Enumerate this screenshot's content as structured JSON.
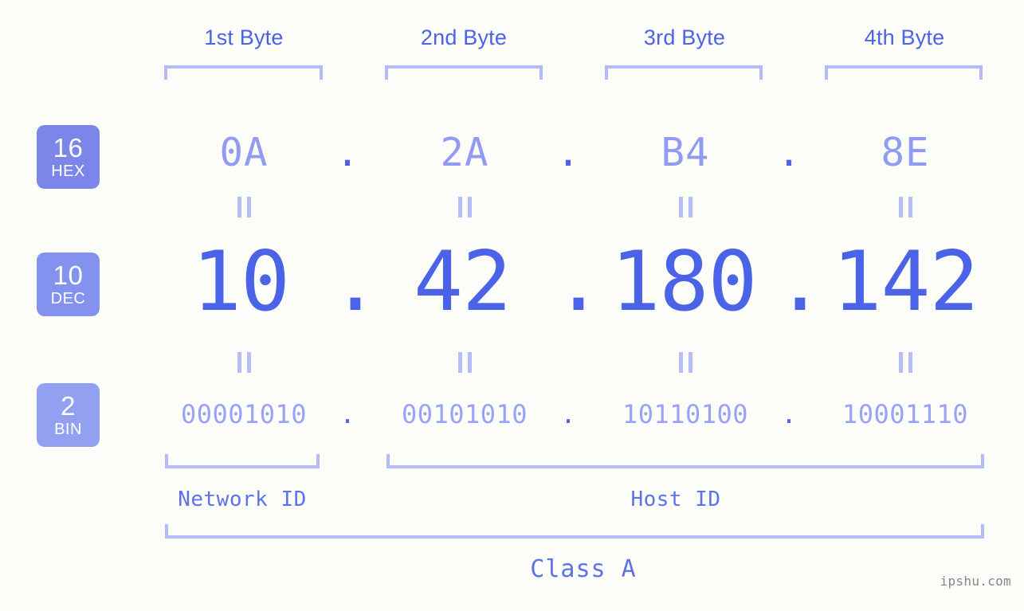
{
  "background_color": "#fcfdf8",
  "accent_color": "#4a63e7",
  "muted_accent_color": "#919bf2",
  "bracket_color": "#b4bcf7",
  "ip_address": "10.42.180.142",
  "byte_headers": [
    {
      "label": "1st Byte"
    },
    {
      "label": "2nd Byte"
    },
    {
      "label": "3rd Byte"
    },
    {
      "label": "4th Byte"
    }
  ],
  "bases": [
    {
      "number": "16",
      "name": "HEX",
      "color": "#7b86e8"
    },
    {
      "number": "10",
      "name": "DEC",
      "color": "#8492ef"
    },
    {
      "number": "2",
      "name": "BIN",
      "color": "#92a0f2"
    }
  ],
  "separator": ".",
  "rows": {
    "hex": {
      "base_number": "16",
      "base_name": "HEX",
      "values": [
        "0A",
        "2A",
        "B4",
        "8E"
      ]
    },
    "dec": {
      "base_number": "10",
      "base_name": "DEC",
      "values": [
        "10",
        "42",
        "180",
        "142"
      ]
    },
    "bin": {
      "base_number": "2",
      "base_name": "BIN",
      "values": [
        "00001010",
        "00101010",
        "10110100",
        "10001110"
      ]
    }
  },
  "equals_symbol": "=",
  "sections": [
    {
      "label": "Network ID"
    },
    {
      "label": "Host ID"
    }
  ],
  "class": {
    "label": "Class A"
  },
  "watermark": {
    "text": "ipshu.com"
  }
}
